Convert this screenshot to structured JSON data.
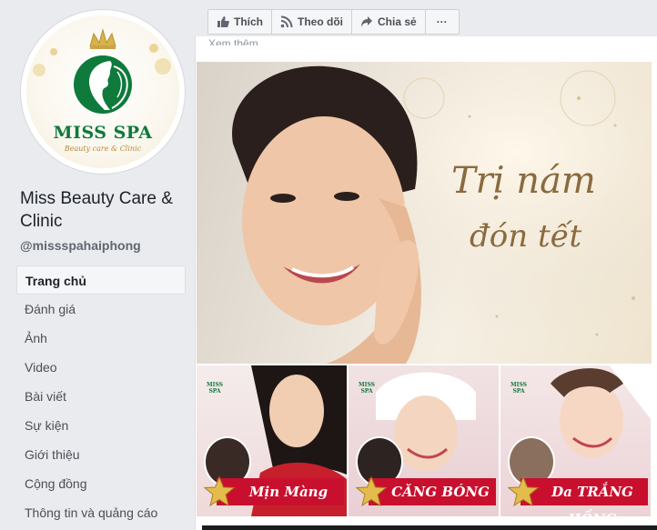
{
  "page": {
    "name": "Miss Beauty Care & Clinic",
    "handle": "@missspahaiphong",
    "logo_title": "MISS SPA",
    "logo_subtitle": "Beauty care & Clinic"
  },
  "nav": {
    "items": [
      {
        "label": "Trang chủ",
        "active": true
      },
      {
        "label": "Đánh giá"
      },
      {
        "label": "Ảnh"
      },
      {
        "label": "Video"
      },
      {
        "label": "Bài viết"
      },
      {
        "label": "Sự kiện"
      },
      {
        "label": "Giới thiệu"
      },
      {
        "label": "Cộng đồng"
      },
      {
        "label": "Thông tin và quảng cáo"
      }
    ]
  },
  "actions": {
    "like": "Thích",
    "follow": "Theo dõi",
    "share": "Chia sẻ",
    "more": "···"
  },
  "post": {
    "see_more": "Xem thêm",
    "hero_line1": "Trị nám",
    "hero_line2": "đón tết",
    "thumb_logo": "MISS SPA",
    "thumbs": [
      {
        "banner": "Mịn Màng"
      },
      {
        "banner": "CĂNG BÓNG"
      },
      {
        "banner": "Da TRẮNG HỒNG"
      }
    ]
  },
  "colors": {
    "brand_green": "#0e7a3b",
    "gold": "#c9a44a",
    "banner_red": "#c8102e",
    "fb_bg": "#e9ebee"
  }
}
